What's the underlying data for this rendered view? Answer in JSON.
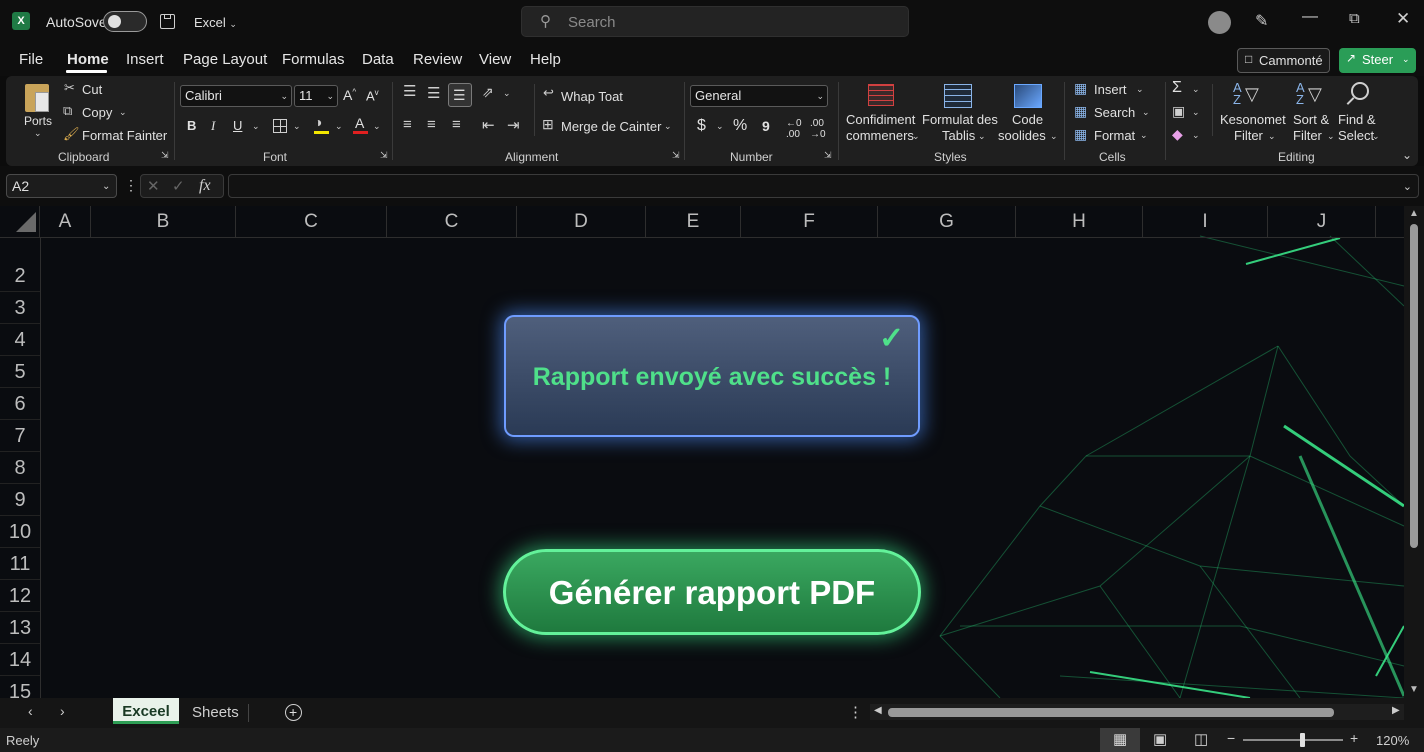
{
  "titlebar": {
    "autosave_label": "AutoSove",
    "app_name": "Excel",
    "search_placeholder": "Search"
  },
  "menu": {
    "items": [
      "File",
      "Home",
      "Insert",
      "Page Layout",
      "Formulas",
      "Data",
      "Review",
      "View",
      "Help"
    ],
    "active": "Home",
    "comments_label": "Cammonté",
    "share_label": "Steer"
  },
  "ribbon": {
    "clipboard": {
      "paste": "Ports",
      "cut": "Cut",
      "copy": "Copy",
      "format_painter": "Format Fainter",
      "label": "Clipboard"
    },
    "font": {
      "name": "Calibri",
      "size": "11",
      "bold": "B",
      "italic": "I",
      "underline": "U",
      "label": "Font"
    },
    "alignment": {
      "wrap": "Whap Toat",
      "merge": "Merge de Cainter",
      "label": "Alignment"
    },
    "number": {
      "format": "General",
      "currency": "$",
      "percent": "%",
      "comma": "9",
      "label": "Number"
    },
    "styles": {
      "conditional_1": "Confidiment",
      "conditional_2": "commeners",
      "table_1": "Formulat des",
      "table_2": "Tablis",
      "cell_1": "Code",
      "cell_2": "soolides",
      "label": "Styles"
    },
    "cells": {
      "insert": "Insert",
      "delete": "Search",
      "format": "Format",
      "label": "Cells"
    },
    "editing": {
      "sigma": "Σ",
      "kes_1": "Kesonomet",
      "kes_2": "Filter",
      "sort_1": "Sort &",
      "sort_2": "Filter",
      "find_1": "Find &",
      "find_2": "Select",
      "label": "Editing"
    }
  },
  "formula": {
    "name_box": "A2",
    "fx": "fx",
    "value": ""
  },
  "grid": {
    "columns": [
      "A",
      "B",
      "C",
      "C",
      "D",
      "E",
      "F",
      "G",
      "H",
      "I",
      "J"
    ],
    "rows": [
      "2",
      "3",
      "4",
      "5",
      "6",
      "7",
      "8",
      "9",
      "10",
      "11",
      "12",
      "13",
      "14",
      "15"
    ]
  },
  "overlay": {
    "success_message": "Rapport envoyé avec succès !",
    "generate_button": "Générer rapport PDF"
  },
  "sheets": {
    "tabs": [
      "Exceel",
      "Sheets"
    ],
    "active": "Exceel"
  },
  "status": {
    "ready": "Reely",
    "zoom": "120%",
    "zoom_level": 0.6
  },
  "colors": {
    "accent_green": "#4fe08a",
    "button_green": "#2e9e55",
    "excel_green": "#1f7a45",
    "glow_blue": "#4f8fff"
  }
}
